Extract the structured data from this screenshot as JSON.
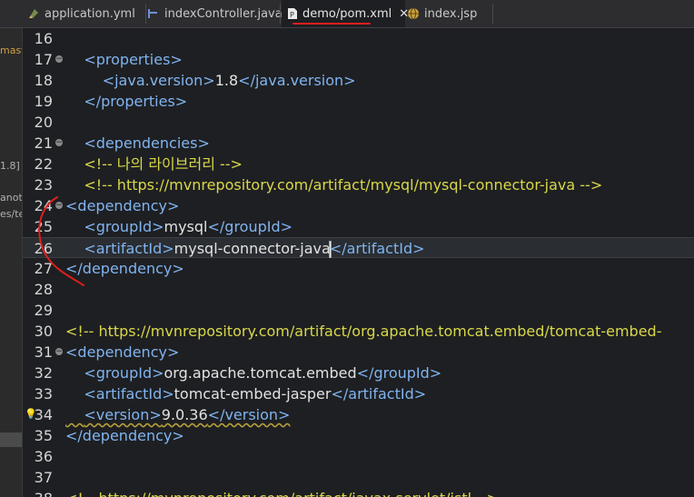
{
  "tabs": [
    {
      "label": "application.yml",
      "icon": "yaml-file-icon",
      "active": false
    },
    {
      "label": "indexController.java",
      "icon": "java-file-icon",
      "active": false
    },
    {
      "label": "demo/pom.xml",
      "icon": "xml-file-icon",
      "active": true,
      "close": "✕"
    },
    {
      "label": "index.jsp",
      "icon": "jsp-globe-icon",
      "active": false
    }
  ],
  "left_strip": [
    "mast",
    "1.8]",
    "anota",
    "es/te"
  ],
  "editor": {
    "current_line": 26,
    "lines": [
      {
        "n": "16",
        "code": ""
      },
      {
        "n": "17",
        "code": "    <properties>"
      },
      {
        "n": "18",
        "code": "        <java.version>1.8</java.version>"
      },
      {
        "n": "19",
        "code": "    </properties>"
      },
      {
        "n": "20",
        "code": ""
      },
      {
        "n": "21",
        "code": "    <dependencies>"
      },
      {
        "n": "22",
        "code": "    <!-- 나의 라이브러리 -->"
      },
      {
        "n": "23",
        "code": "    <!-- https://mvnrepository.com/artifact/mysql/mysql-connector-java -->"
      },
      {
        "n": "24",
        "code": "<dependency>"
      },
      {
        "n": "25",
        "code": "    <groupId>mysql</groupId>"
      },
      {
        "n": "26",
        "code": "    <artifactId>mysql-connector-java</artifactId>"
      },
      {
        "n": "27",
        "code": "</dependency>"
      },
      {
        "n": "28",
        "code": ""
      },
      {
        "n": "29",
        "code": ""
      },
      {
        "n": "30",
        "code": "<!-- https://mvnrepository.com/artifact/org.apache.tomcat.embed/tomcat-embed-"
      },
      {
        "n": "31",
        "code": "<dependency>"
      },
      {
        "n": "32",
        "code": "    <groupId>org.apache.tomcat.embed</groupId>"
      },
      {
        "n": "33",
        "code": "    <artifactId>tomcat-embed-jasper</artifactId>"
      },
      {
        "n": "34",
        "code": "    <version>9.0.36</version>"
      },
      {
        "n": "35",
        "code": "</dependency>"
      },
      {
        "n": "36",
        "code": ""
      },
      {
        "n": "37",
        "code": ""
      },
      {
        "n": "38",
        "code": "<!-- https://mvnrepository.com/artifact/javax.servlet/jstl -->"
      }
    ]
  },
  "colors": {
    "tag": "#80b4f0",
    "text": "#e2e2e2",
    "comment": "#d8d84a",
    "annotation": "#e01e1e"
  }
}
